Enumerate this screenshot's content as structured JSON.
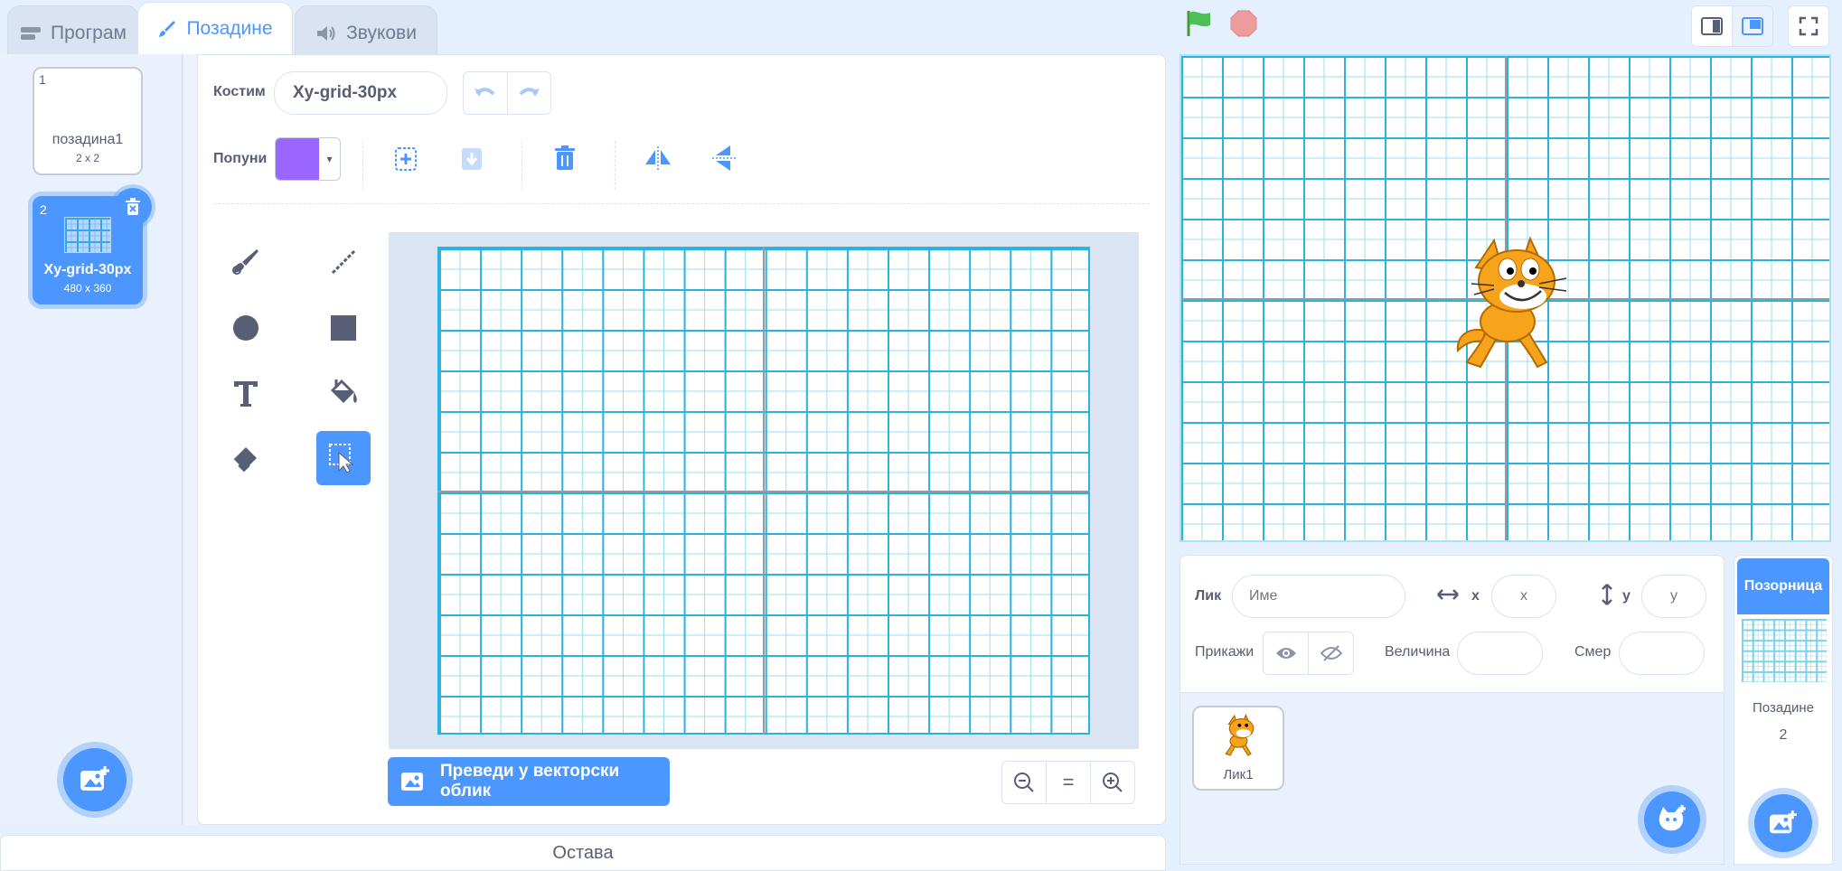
{
  "tabs": [
    {
      "label": "Програм",
      "icon": "code-icon"
    },
    {
      "label": "Позадине",
      "icon": "brush-icon"
    },
    {
      "label": "Звукови",
      "icon": "speaker-icon"
    }
  ],
  "costumes": [
    {
      "number": "1",
      "name": "позадина1",
      "size": "2 x 2"
    },
    {
      "number": "2",
      "name": "Xy-grid-30px",
      "size": "480 x 360"
    }
  ],
  "editor": {
    "costume_label": "Костим",
    "costume_name": "Xy-grid-30px",
    "fill_label": "Попуни",
    "fill_color": "#9966ff",
    "convert_label": "Преведи у векторски облик",
    "zoom_reset": "="
  },
  "backpack_label": "Остава",
  "sprite_info": {
    "sprite_label": "Лик",
    "name_placeholder": "Име",
    "x_label": "x",
    "x_placeholder": "x",
    "y_label": "y",
    "y_placeholder": "y",
    "show_label": "Прикажи",
    "size_label": "Величина",
    "direction_label": "Смер"
  },
  "sprites": [
    {
      "name": "Лик1"
    }
  ],
  "stage_panel": {
    "header": "Позорница",
    "backdrops_label": "Позадине",
    "backdrops_count": "2"
  },
  "colors": {
    "accent": "#4c97ff",
    "grid_major": "#2ab3df",
    "grid_minor": "#9adcf0",
    "green_flag": "#4cbf56",
    "stop": "#ec9c9c"
  }
}
